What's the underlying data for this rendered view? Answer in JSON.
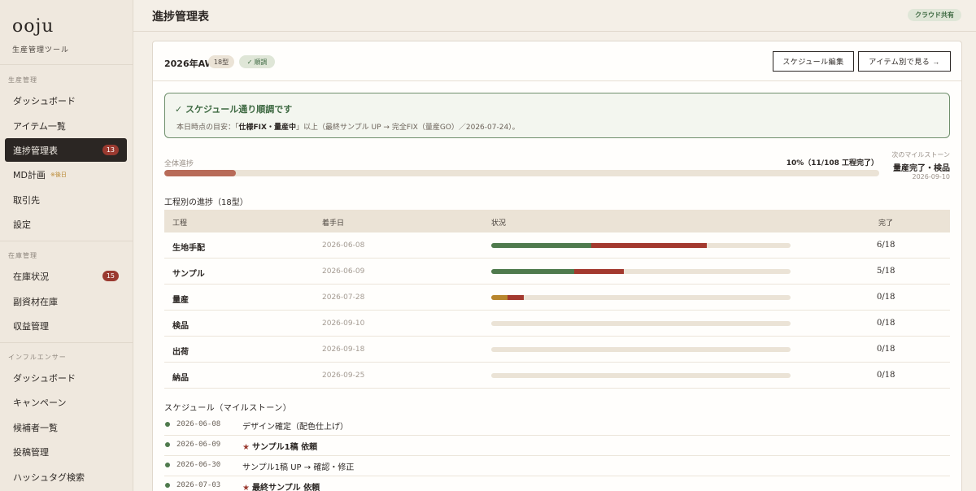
{
  "sidebar": {
    "logo": "ooju",
    "logo_sub": "生産管理ツール",
    "sections": [
      {
        "title": "生産管理",
        "items": [
          {
            "label": "ダッシュボード"
          },
          {
            "label": "アイテム一覧"
          },
          {
            "label": "進捗管理表",
            "badge": "13",
            "active": true
          },
          {
            "label": "MD計画",
            "note": "※後日"
          },
          {
            "label": "取引先"
          },
          {
            "label": "設定"
          }
        ]
      },
      {
        "title": "在庫管理",
        "items": [
          {
            "label": "在庫状況",
            "badge": "15"
          },
          {
            "label": "副資材在庫"
          },
          {
            "label": "収益管理"
          }
        ]
      },
      {
        "title": "インフルエンサー",
        "items": [
          {
            "label": "ダッシュボード"
          },
          {
            "label": "キャンペーン"
          },
          {
            "label": "候補者一覧"
          },
          {
            "label": "投稿管理"
          },
          {
            "label": "ハッシュタグ検索"
          }
        ]
      }
    ]
  },
  "header": {
    "title": "進捗管理表",
    "cloud_badge": "クラウド共有"
  },
  "card": {
    "season": "2026年AW",
    "count_chip": "18型",
    "ok_chip": "順調",
    "btn_schedule": "スケジュール編集",
    "btn_items": "アイテム別で見る →",
    "alert": {
      "title": "スケジュール通り順調です",
      "body_prefix": "本日時点の目安：「",
      "body_bold": "仕様FIX・量産中",
      "body_suffix": "」以上（最終サンプル UP → 完全FIX（量産GO）／2026-07-24）。"
    },
    "progress": {
      "label": "全体進捗",
      "value_text": "10%（11/108 工程完了）",
      "percent": 10,
      "next_label": "次のマイルストーン",
      "next_name": "量産完了・検品",
      "next_date": "2026-09-10"
    },
    "table": {
      "title": "工程別の進捗（18型）",
      "headers": [
        "工程",
        "着手日",
        "状況",
        "完了"
      ],
      "rows": [
        {
          "name": "生地手配",
          "date": "2026-06-08",
          "done": "6/18",
          "segments": [
            {
              "color": "#4f7a4d",
              "pct": 33.5
            },
            {
              "color": "#a3392e",
              "pct": 38.5
            }
          ]
        },
        {
          "name": "サンプル",
          "date": "2026-06-09",
          "done": "5/18",
          "segments": [
            {
              "color": "#4f7a4d",
              "pct": 27.8
            },
            {
              "color": "#a3392e",
              "pct": 16.5
            }
          ]
        },
        {
          "name": "量産",
          "date": "2026-07-28",
          "done": "0/18",
          "segments": [
            {
              "color": "#b8862e",
              "pct": 5.5
            },
            {
              "color": "#a3392e",
              "pct": 5.5
            }
          ]
        },
        {
          "name": "検品",
          "date": "2026-09-10",
          "done": "0/18",
          "segments": []
        },
        {
          "name": "出荷",
          "date": "2026-09-18",
          "done": "0/18",
          "segments": []
        },
        {
          "name": "納品",
          "date": "2026-09-25",
          "done": "0/18",
          "segments": []
        }
      ]
    },
    "schedule": {
      "title": "スケジュール（マイルストーン）",
      "items": [
        {
          "date": "2026-06-08",
          "text": "デザイン確定（配色仕上げ）",
          "star": false
        },
        {
          "date": "2026-06-09",
          "text": "サンプル1稿 依頼",
          "star": true
        },
        {
          "date": "2026-06-30",
          "text": "サンプル1稿 UP → 確認・修正",
          "star": false
        },
        {
          "date": "2026-07-03",
          "text": "最終サンプル 依頼",
          "star": true
        }
      ]
    }
  },
  "colors": {
    "accent_dark": "#2b2623",
    "ok_green": "#3f6a43",
    "badge_red": "#9a3a30",
    "progress_fill": "#b86b58"
  }
}
